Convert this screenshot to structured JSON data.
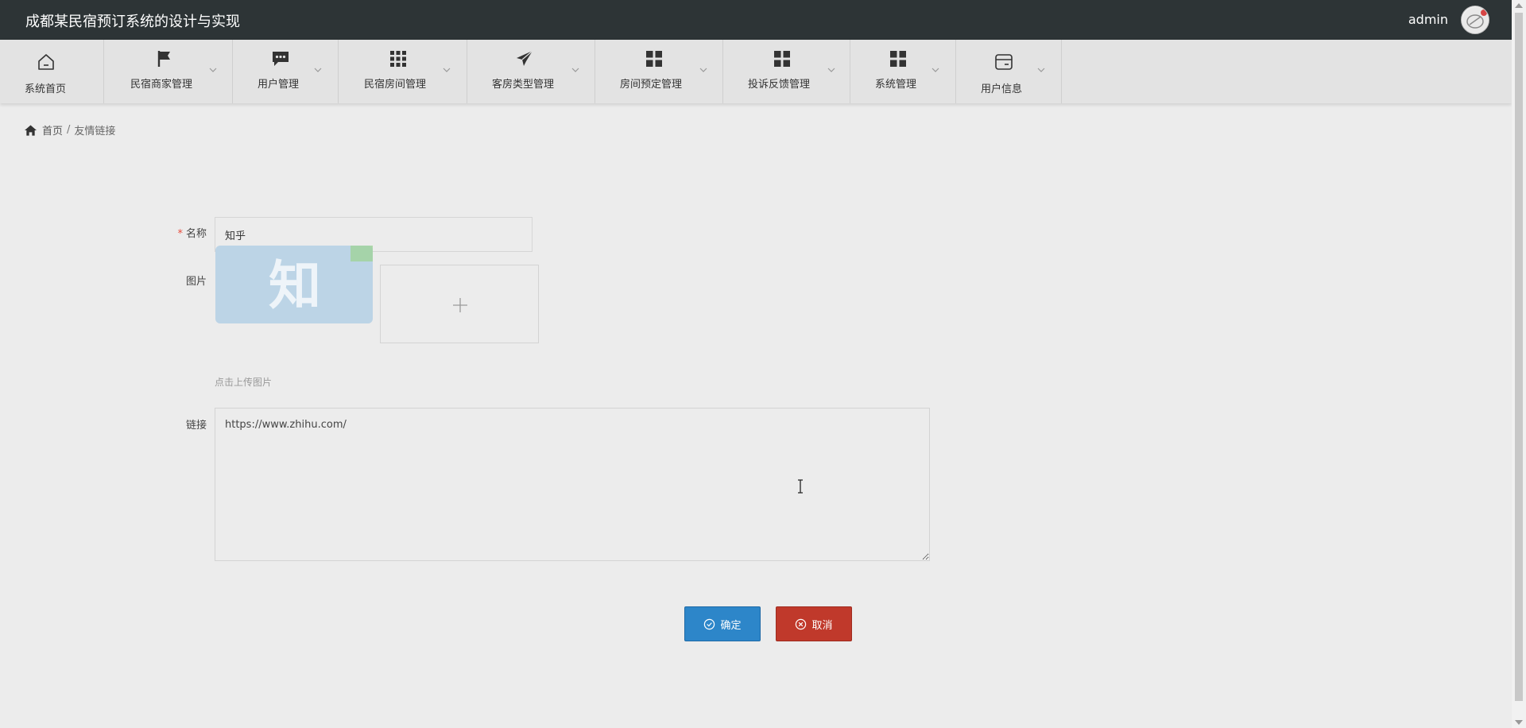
{
  "header": {
    "title": "成都某民宿预订系统的设计与实现",
    "username": "admin"
  },
  "nav": {
    "items": [
      {
        "label": "系统首页",
        "icon": "home-icon"
      },
      {
        "label": "民宿商家管理",
        "icon": "flag-icon"
      },
      {
        "label": "用户管理",
        "icon": "chat-icon"
      },
      {
        "label": "民宿房间管理",
        "icon": "grid-icon"
      },
      {
        "label": "客房类型管理",
        "icon": "paper-plane-icon"
      },
      {
        "label": "房间预定管理",
        "icon": "apps-icon"
      },
      {
        "label": "投诉反馈管理",
        "icon": "apps-icon"
      },
      {
        "label": "系统管理",
        "icon": "apps-icon"
      },
      {
        "label": "用户信息",
        "icon": "card-icon"
      }
    ]
  },
  "breadcrumb": {
    "home": "首页",
    "separator": "/",
    "current": "友情链接"
  },
  "form": {
    "name_label": "名称",
    "name_required_mark": "*",
    "name_value": "知乎",
    "image_label": "图片",
    "image_logo_text": "知",
    "upload_hint": "点击上传图片",
    "link_label": "链接",
    "link_value": "https://www.zhihu.com/"
  },
  "buttons": {
    "confirm": "确定",
    "cancel": "取消"
  },
  "colors": {
    "header_bg": "#2d3436",
    "confirm": "#2d86c9",
    "cancel": "#c0392b",
    "required": "#e74c3c"
  }
}
